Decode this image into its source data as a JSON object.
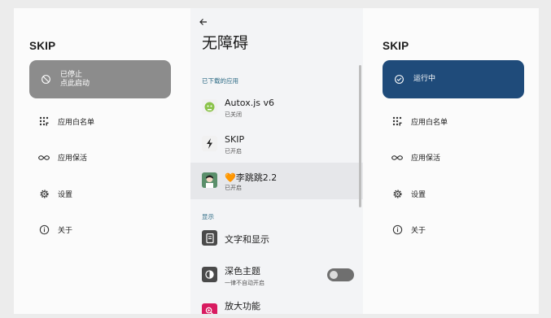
{
  "left": {
    "title": "SKIP",
    "status": {
      "line1": "已停止",
      "line2": "点此启动",
      "color": "#8c8c8c"
    },
    "menu": [
      {
        "label": "应用白名单",
        "icon": "apps-grid-icon"
      },
      {
        "label": "应用保活",
        "icon": "infinity-icon"
      },
      {
        "label": "设置",
        "icon": "gear-icon"
      },
      {
        "label": "关于",
        "icon": "info-icon"
      }
    ]
  },
  "middle": {
    "title": "无障碍",
    "downloaded_label": "已下载的应用",
    "apps": [
      {
        "name": "Autox.js v6",
        "state": "已关闭",
        "icon": "autox-icon"
      },
      {
        "name": "SKIP",
        "state": "已开启",
        "icon": "skip-icon"
      },
      {
        "name": "🧡李跳跳2.2",
        "state": "已开启",
        "icon": "litiaotiao-icon"
      }
    ],
    "display_label": "显示",
    "settings": [
      {
        "name": "文字和显示",
        "icon": "text-display-icon"
      },
      {
        "name": "深色主题",
        "sub": "一律不自动开启",
        "icon": "dark-theme-icon",
        "toggle_on": false
      },
      {
        "name": "放大功能",
        "icon": "magnify-icon"
      }
    ]
  },
  "right": {
    "title": "SKIP",
    "status": {
      "line1": "运行中",
      "color": "#1f4b7a"
    },
    "menu": [
      {
        "label": "应用白名单",
        "icon": "apps-grid-icon"
      },
      {
        "label": "应用保活",
        "icon": "infinity-icon"
      },
      {
        "label": "设置",
        "icon": "gear-icon"
      },
      {
        "label": "关于",
        "icon": "info-icon"
      }
    ]
  }
}
